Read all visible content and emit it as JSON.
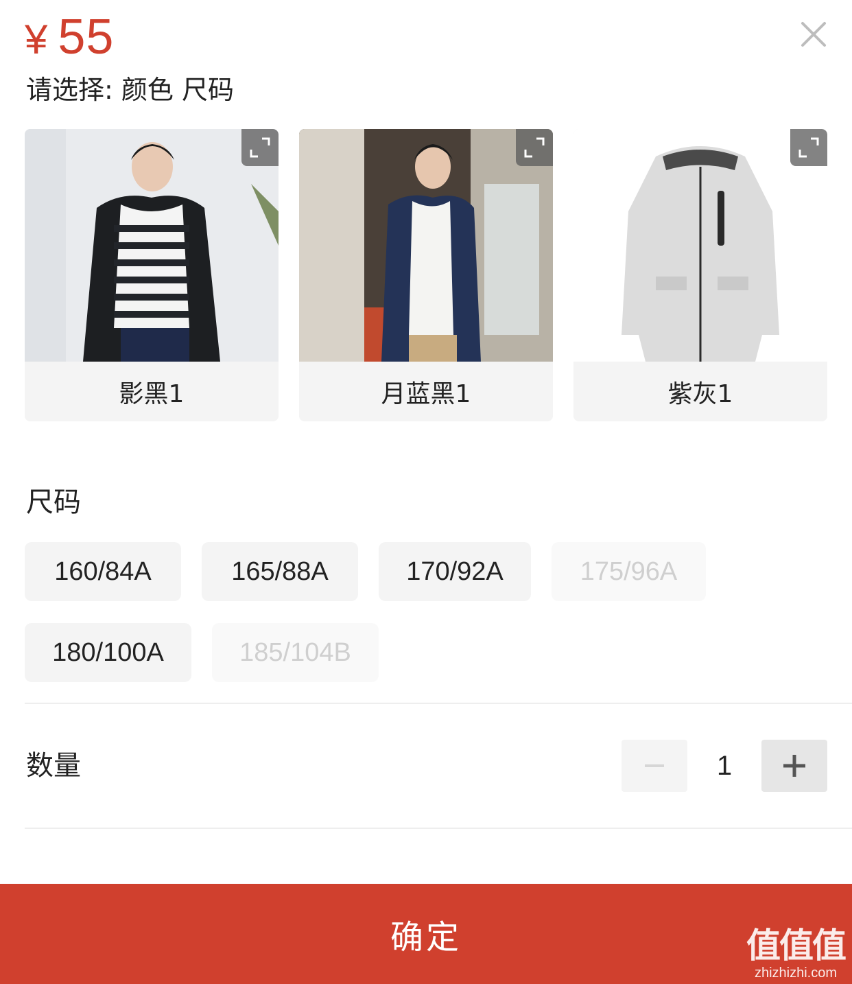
{
  "header": {
    "currency_symbol": "¥",
    "price": "55",
    "subtitle": "请选择: 颜色 尺码"
  },
  "colors": [
    {
      "label": "影黑1"
    },
    {
      "label": "月蓝黑1"
    },
    {
      "label": "紫灰1"
    }
  ],
  "size_section": {
    "title": "尺码",
    "options": [
      {
        "label": "160/84A",
        "available": true
      },
      {
        "label": "165/88A",
        "available": true
      },
      {
        "label": "170/92A",
        "available": true
      },
      {
        "label": "175/96A",
        "available": false
      },
      {
        "label": "180/100A",
        "available": true
      },
      {
        "label": "185/104B",
        "available": false
      }
    ]
  },
  "quantity": {
    "label": "数量",
    "value": "1"
  },
  "footer": {
    "confirm_label": "确定"
  },
  "watermark": {
    "main": "值值值",
    "sub": "zhizhizhi.com"
  },
  "theme": {
    "accent": "#d0402e",
    "disabled_text": "#cfcfcf"
  }
}
